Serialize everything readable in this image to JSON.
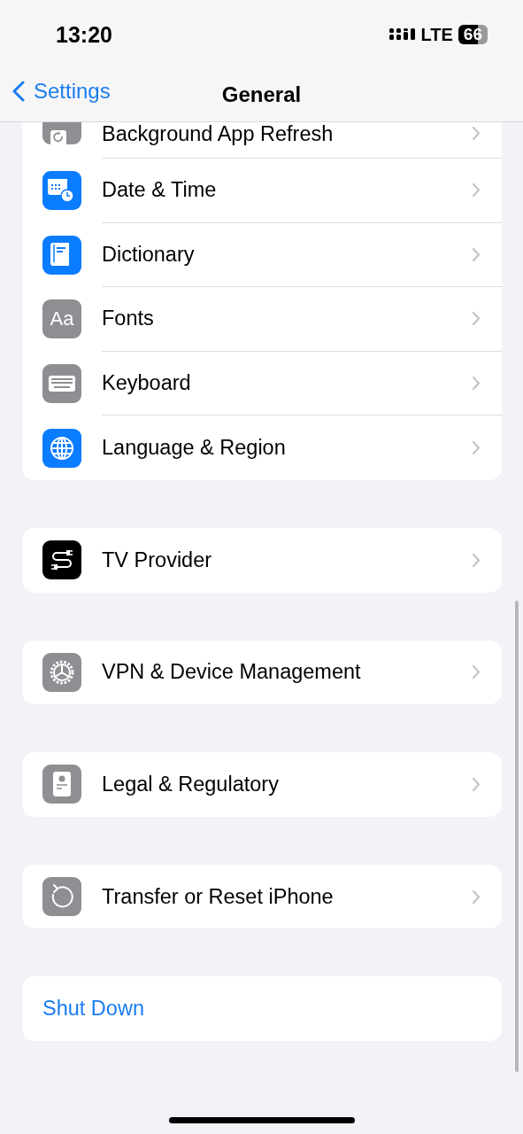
{
  "status_bar": {
    "time": "13:20",
    "network": "LTE",
    "battery": "66"
  },
  "nav": {
    "back": "Settings",
    "title": "General"
  },
  "groups": [
    {
      "rows": [
        {
          "kind": "link",
          "label": "Background App Refresh",
          "color": "#8e8e93"
        },
        {
          "kind": "link",
          "label": "Date & Time",
          "color": "#0a7cff"
        },
        {
          "kind": "link",
          "label": "Dictionary",
          "color": "#0a7cff"
        },
        {
          "kind": "link",
          "label": "Fonts",
          "color": "#8e8e93",
          "icon_text": "Aa"
        },
        {
          "kind": "link",
          "label": "Keyboard",
          "color": "#8e8e93"
        },
        {
          "kind": "link",
          "label": "Language & Region",
          "color": "#0a7cff"
        }
      ]
    },
    {
      "rows": [
        {
          "kind": "link",
          "label": "TV Provider",
          "color": "#000000"
        }
      ]
    },
    {
      "rows": [
        {
          "kind": "link",
          "label": "VPN & Device Management",
          "color": "#8e8e93"
        }
      ]
    },
    {
      "rows": [
        {
          "kind": "link",
          "label": "Legal & Regulatory",
          "color": "#8e8e93"
        }
      ]
    },
    {
      "rows": [
        {
          "kind": "link",
          "label": "Transfer or Reset iPhone",
          "color": "#8e8e93"
        }
      ]
    },
    {
      "rows": [
        {
          "kind": "action",
          "label": "Shut Down"
        }
      ]
    }
  ]
}
